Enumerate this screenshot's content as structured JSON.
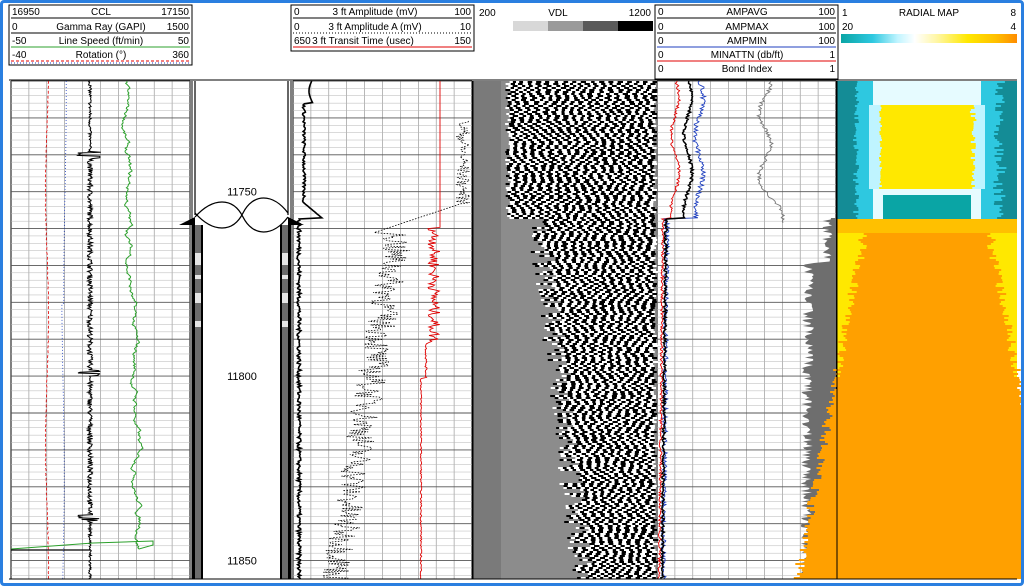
{
  "chart_data": {
    "type": "well-log",
    "depth": {
      "start": 11720,
      "end": 11855,
      "labels": [
        11750,
        11800,
        11850
      ]
    },
    "track1_curves": [
      {
        "name": "CCL",
        "min": "16950",
        "max": "17150",
        "color": "#000000",
        "style": "solid"
      },
      {
        "name": "Gamma Ray (GAPI)",
        "min": "0",
        "max": "1500",
        "color": "#000000",
        "style": "solid"
      },
      {
        "name": "Line Speed (ft/min)",
        "min": "-50",
        "max": "50",
        "color": "#2ca02c",
        "style": "solid"
      },
      {
        "name": "Rotation (°)",
        "min": "-40",
        "max": "360",
        "color": "#1f3fbf",
        "style": "dotted"
      }
    ],
    "track3_curves": [
      {
        "name": "3 ft Amplitude (mV)",
        "min": "0",
        "max": "100",
        "color": "#000000",
        "style": "solid"
      },
      {
        "name": "3 ft Amplitude A (mV)",
        "min": "0",
        "max": "10",
        "color": "#000000",
        "style": "dotted"
      },
      {
        "name": "3 ft Transit Time (usec)",
        "min": "650",
        "max": "150",
        "color": "#e00000",
        "style": "solid"
      }
    ],
    "vdl": {
      "name": "VDL",
      "min": "200",
      "max": "1200"
    },
    "track5_curves": [
      {
        "name": "AMPAVG",
        "min": "0",
        "max": "100",
        "color": "#000000"
      },
      {
        "name": "AMPMAX",
        "min": "0",
        "max": "100",
        "color": "#000000"
      },
      {
        "name": "AMPMIN",
        "min": "0",
        "max": "100",
        "color": "#1f3fbf"
      },
      {
        "name": "MINATTN (db/ft)",
        "min": "0",
        "max": "1",
        "color": "#e00000"
      },
      {
        "name": "Bond Index",
        "min": "0",
        "max": "1",
        "color": "#000000"
      }
    ],
    "radial_map": {
      "name": "RADIAL MAP",
      "left_value": "1",
      "right_value": "8",
      "scale_min": "20",
      "scale_max": "4"
    },
    "colors": {
      "border": "#2a7fe0",
      "cyan": "#2ec8e0",
      "yellow": "#ffe800",
      "orange": "#ffa000",
      "teal": "#148c96"
    }
  }
}
